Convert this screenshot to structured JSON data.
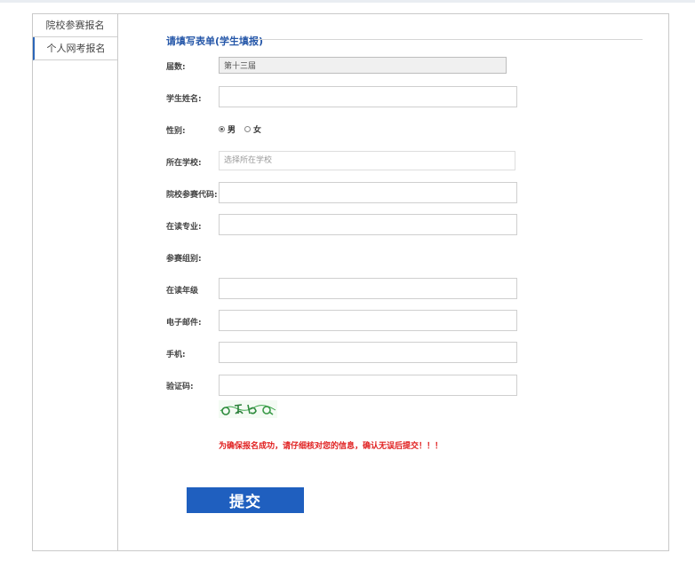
{
  "sidebar": {
    "items": [
      {
        "label": "院校参赛报名"
      },
      {
        "label": "个人网考报名"
      }
    ]
  },
  "form": {
    "title": "请填写表单(学生填报)",
    "session": {
      "label": "届数:",
      "value": "第十三届"
    },
    "student_name": {
      "label": "学生姓名:"
    },
    "gender": {
      "label": "性别:",
      "options": [
        "男",
        "女"
      ],
      "selected": "男"
    },
    "school": {
      "label": "所在学校:",
      "placeholder": "选择所在学校"
    },
    "school_code": {
      "label": "院校参赛代码:"
    },
    "major": {
      "label": "在读专业:"
    },
    "group": {
      "label": "参赛组别:"
    },
    "grade": {
      "label": "在读年级"
    },
    "email": {
      "label": "电子邮件:"
    },
    "phone": {
      "label": "手机:"
    },
    "captcha": {
      "label": "验证码:"
    },
    "warning": "为确保报名成功，请仔细核对您的信息，确认无误后提交！！！",
    "submit_label": "提交"
  },
  "colors": {
    "accent": "#1f5fbf",
    "title": "#2456a8",
    "warning": "#e02020"
  }
}
